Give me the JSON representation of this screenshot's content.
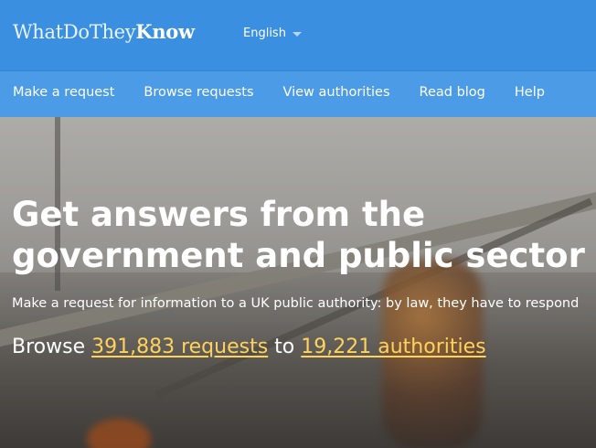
{
  "header": {
    "brand_regular": "WhatDoThey",
    "brand_bold": "Know",
    "language": "English"
  },
  "nav": {
    "items": [
      "Make a request",
      "Browse requests",
      "View authorities",
      "Read blog",
      "Help"
    ]
  },
  "hero": {
    "title": "Get answers from the government and public sector",
    "subtitle": "Make a request for information to a UK public authority: by law, they have to respond",
    "browse_prefix": "Browse",
    "requests_link": "391,883 requests",
    "connector": "to",
    "authorities_link": "19,221 authorities"
  },
  "colors": {
    "header_bg": "#3a8fe0",
    "nav_bg": "#4c9be6",
    "link_yellow": "#ffd25c"
  },
  "icons": [
    "caret-down-icon"
  ]
}
